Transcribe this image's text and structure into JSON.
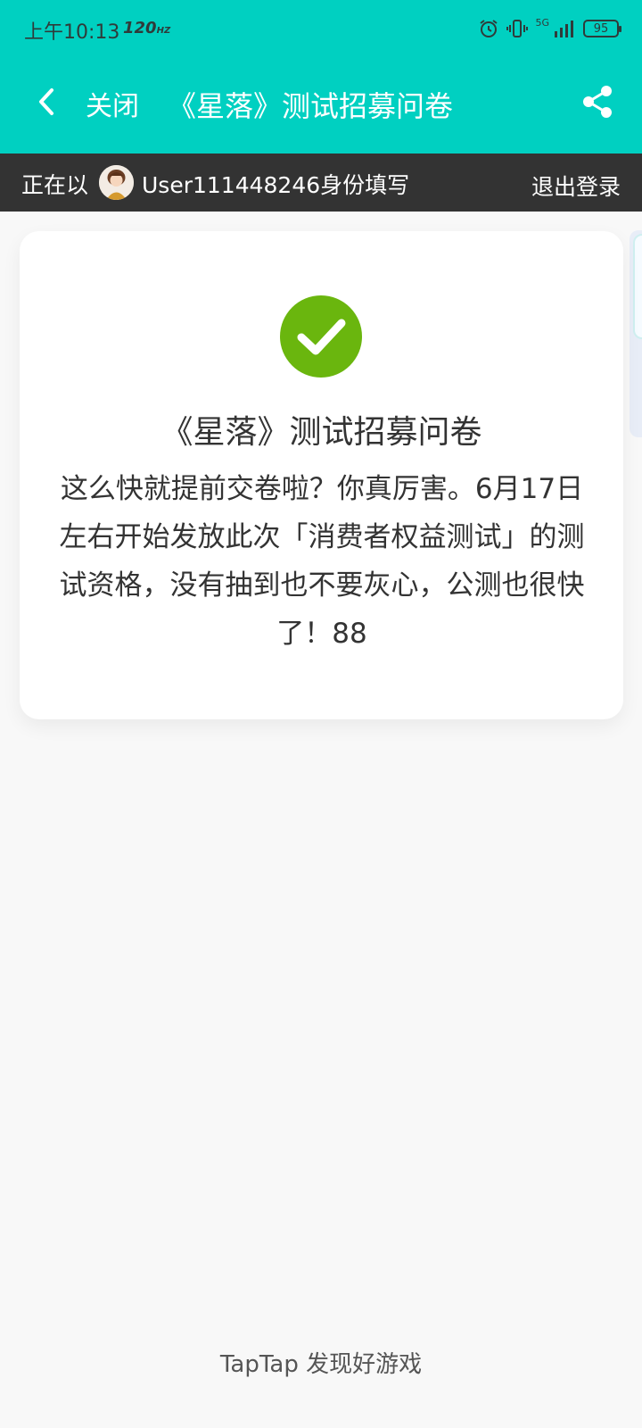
{
  "status_bar": {
    "time": "上午10:13",
    "refresh_rate": "120",
    "refresh_unit": "HZ",
    "network": "5G",
    "battery": "95"
  },
  "app_bar": {
    "close_label": "关闭",
    "title": "《星落》测试招募问卷",
    "icons": [
      "chevron-left-icon",
      "share-icon"
    ]
  },
  "user_bar": {
    "prefix": "正在以",
    "username": "User111448246身份填写",
    "logout": "退出登录"
  },
  "result_card": {
    "title": "《星落》测试招募问卷",
    "message": "这么快就提前交卷啦？你真厉害。6月17日左右开始发放此次「消费者权益测试」的测试资格，没有抽到也不要灰心，公测也很快了！88",
    "icon": "check-circle-icon"
  },
  "footer": {
    "text": "TapTap 发现好游戏"
  },
  "colors": {
    "brand": "#00d0c1",
    "user_bar": "#333333",
    "success": "#6ab60e"
  }
}
